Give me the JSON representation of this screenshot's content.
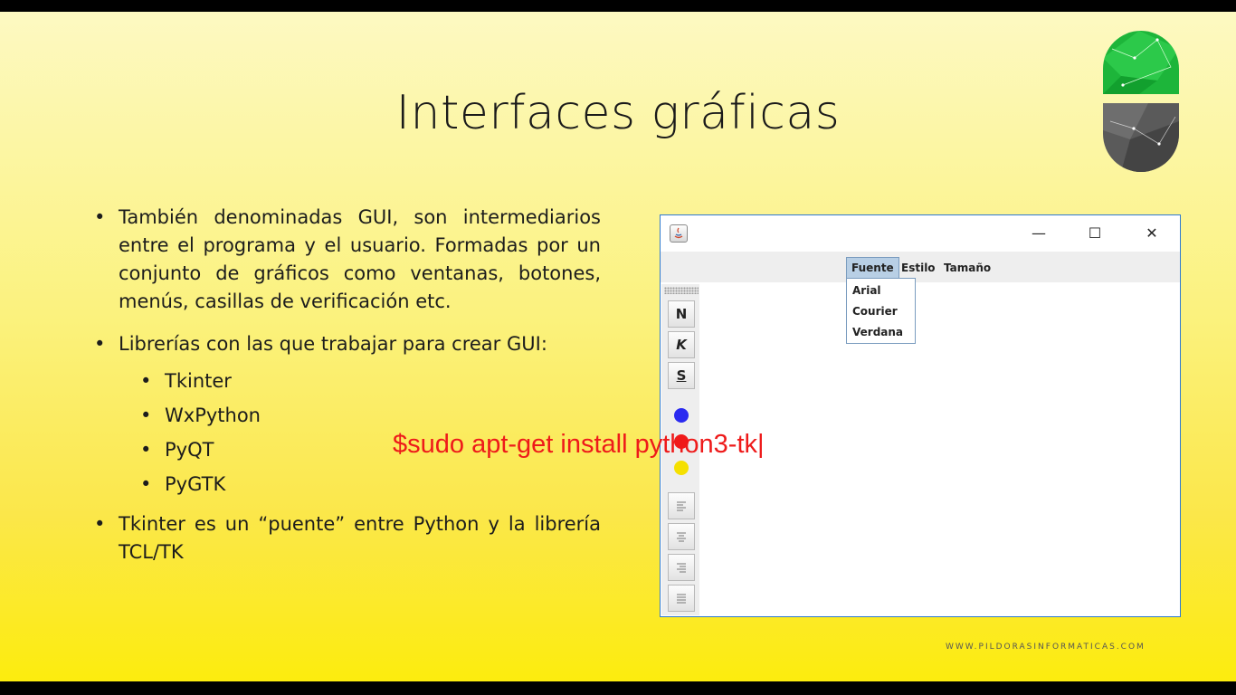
{
  "slide": {
    "title": "Interfaces gráficas",
    "bullets": [
      "También denominadas GUI, son intermediarios entre el programa y el usuario. Formadas por un conjunto de gráficos como ventanas, botones, menús, casillas de verificación etc.",
      "Librerías con las que trabajar para crear GUI:",
      "Tkinter es un “puente” entre Python y la librería TCL/TK"
    ],
    "libraries": [
      "Tkinter",
      "WxPython",
      "PyQT",
      "PyGTK"
    ],
    "footer": "WWW.PILDORASINFORMATICAS.COM"
  },
  "overlay_command": "$sudo apt-get install python3-tk|",
  "window": {
    "controls": {
      "minimize": "—",
      "maximize": "☐",
      "close": "✕"
    },
    "menus": [
      "Fuente",
      "Estilo",
      "Tamaño"
    ],
    "open_menu_items": [
      "Arial",
      "Courier",
      "Verdana"
    ],
    "toolbar": {
      "bold": "N",
      "italic": "K",
      "underline": "S",
      "colors": [
        "#2a2af0",
        "#f01a1a",
        "#f5e000"
      ],
      "align_icons": [
        "align-left-icon",
        "align-center-icon",
        "align-right-icon",
        "align-justify-icon"
      ]
    }
  }
}
